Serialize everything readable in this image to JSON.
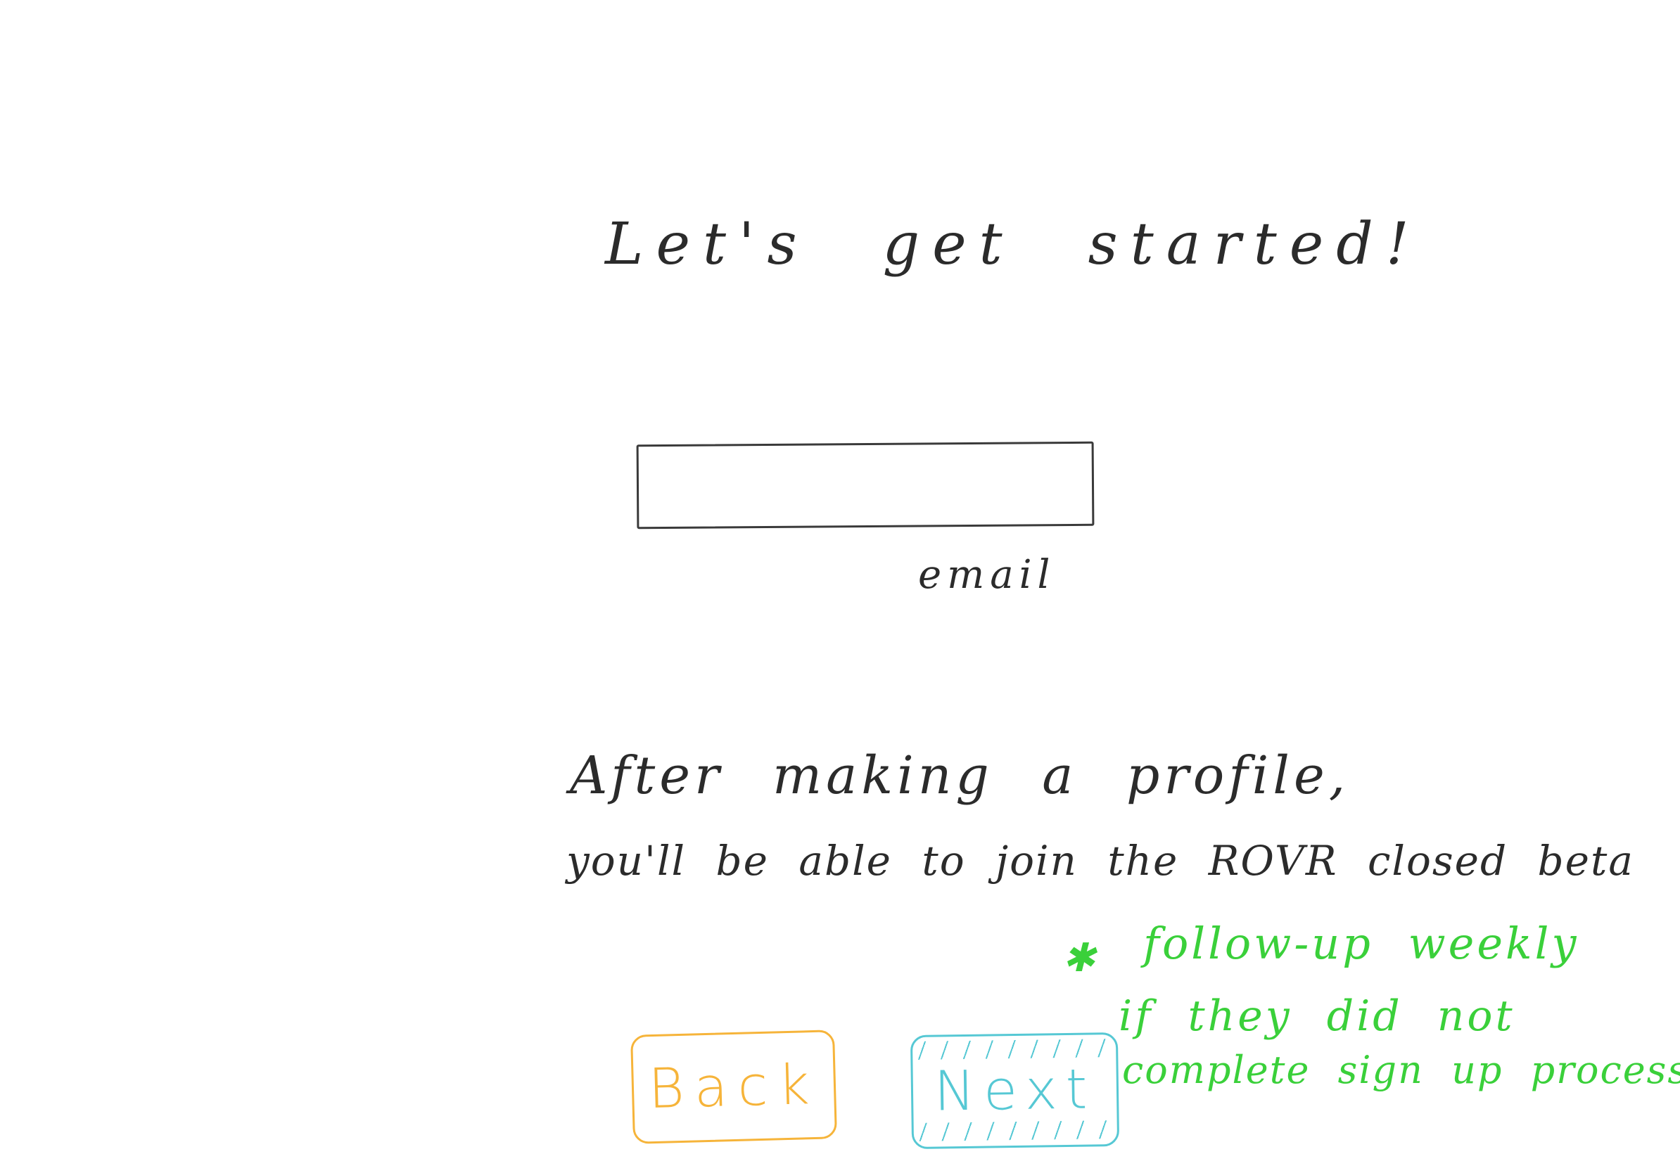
{
  "heading": {
    "title": "Let's get started!"
  },
  "form": {
    "email_value": "",
    "email_label": "email"
  },
  "description": {
    "line1": "After making a profile,",
    "line2": "you'll be able to join the ROVR closed beta"
  },
  "buttons": {
    "back_label": "Back",
    "next_label": "Next"
  },
  "annotation": {
    "marker": "✱",
    "line1": "follow-up weekly",
    "line2": "if they did not",
    "line3": "complete sign up process"
  },
  "colors": {
    "ink": "#2b2b2b",
    "back_accent": "#f6b43a",
    "next_accent": "#56c8d4",
    "annotation": "#3ad03a"
  }
}
